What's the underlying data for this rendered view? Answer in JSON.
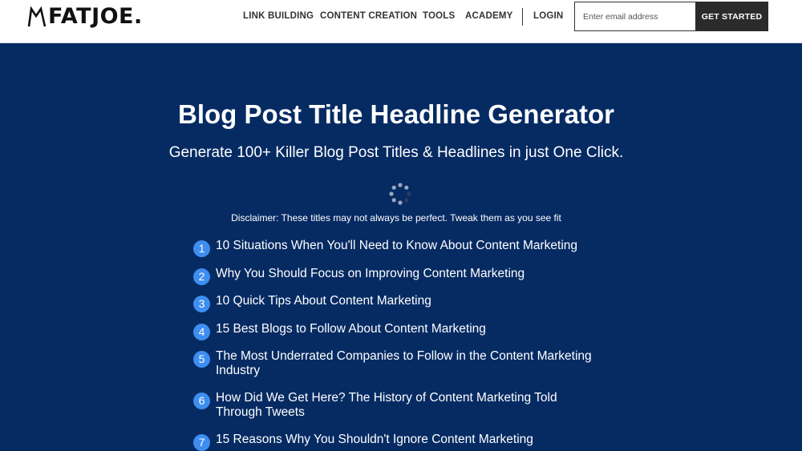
{
  "header": {
    "logo_text": "FATJOE.",
    "nav": [
      {
        "label": "LINK BUILDING"
      },
      {
        "label": "CONTENT CREATION"
      },
      {
        "label": "TOOLS"
      },
      {
        "label": "ACADEMY"
      },
      {
        "label": "LOGIN"
      }
    ],
    "email_placeholder": "Enter email address",
    "email_value": "",
    "cta_label": "GET STARTED"
  },
  "hero": {
    "title": "Blog Post Title Headline Generator",
    "subtitle": "Generate 100+ Killer Blog Post Titles & Headlines in just One Click.",
    "disclaimer": "Disclaimer: These titles may not always be perfect. Tweak them as you see fit"
  },
  "titles": [
    {
      "num": "1",
      "text": "10 Situations When You'll Need to Know About Content Marketing"
    },
    {
      "num": "2",
      "text": "Why You Should Focus on Improving Content Marketing"
    },
    {
      "num": "3",
      "text": "10 Quick Tips About Content Marketing"
    },
    {
      "num": "4",
      "text": "15 Best Blogs to Follow About Content Marketing"
    },
    {
      "num": "5",
      "text": "The Most Underrated Companies to Follow in the Content Marketing Industry"
    },
    {
      "num": "6",
      "text": "How Did We Get Here? The History of Content Marketing Told Through Tweets"
    },
    {
      "num": "7",
      "text": "15 Reasons Why You Shouldn't Ignore Content Marketing"
    }
  ],
  "colors": {
    "background": "#062b63",
    "badge": "#3d8ef0",
    "cta": "#2b2b2b"
  }
}
